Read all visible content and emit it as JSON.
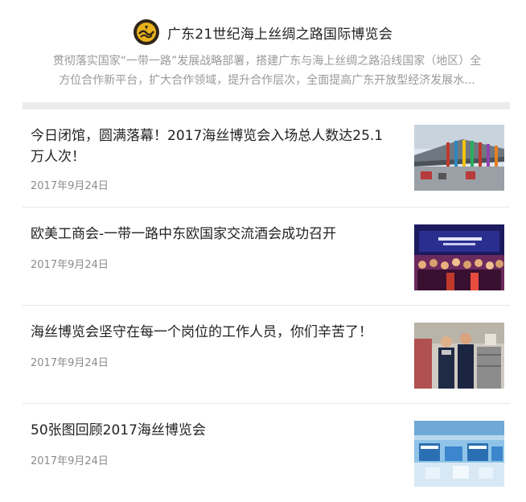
{
  "account": {
    "name": "广东21世纪海上丝绸之路国际博览会",
    "description_lines": [
      "贯彻落实国家“一带一路”发展战略部署，搭建广东与海上丝绸之路沿线国家（地区）全",
      "方位合作新平台，扩大合作领域，提升合作层次，全面提高广东开放型经济发展水..."
    ],
    "logo_icon": "expo-logo-icon"
  },
  "articles": [
    {
      "title_lines": [
        "今日闭馆，圆满落幕！2017海丝博览会入场总人数达25.1",
        "万人次！"
      ],
      "date": "2017年9月24日",
      "thumb_icon": "venue-entrance-photo"
    },
    {
      "title_lines": [
        "欧美工商会-一带一路中东欧国家交流酒会成功召开"
      ],
      "date": "2017年9月24日",
      "thumb_icon": "reception-crowd-photo"
    },
    {
      "title_lines": [
        "海丝博览会坚守在每一个岗位的工作人员，你们辛苦了！"
      ],
      "date": "2017年9月24日",
      "thumb_icon": "staff-police-photo"
    },
    {
      "title_lines": [
        "50张图回顾2017海丝博览会"
      ],
      "date": "2017年9月24日",
      "thumb_icon": "exhibition-hall-photo"
    }
  ]
}
